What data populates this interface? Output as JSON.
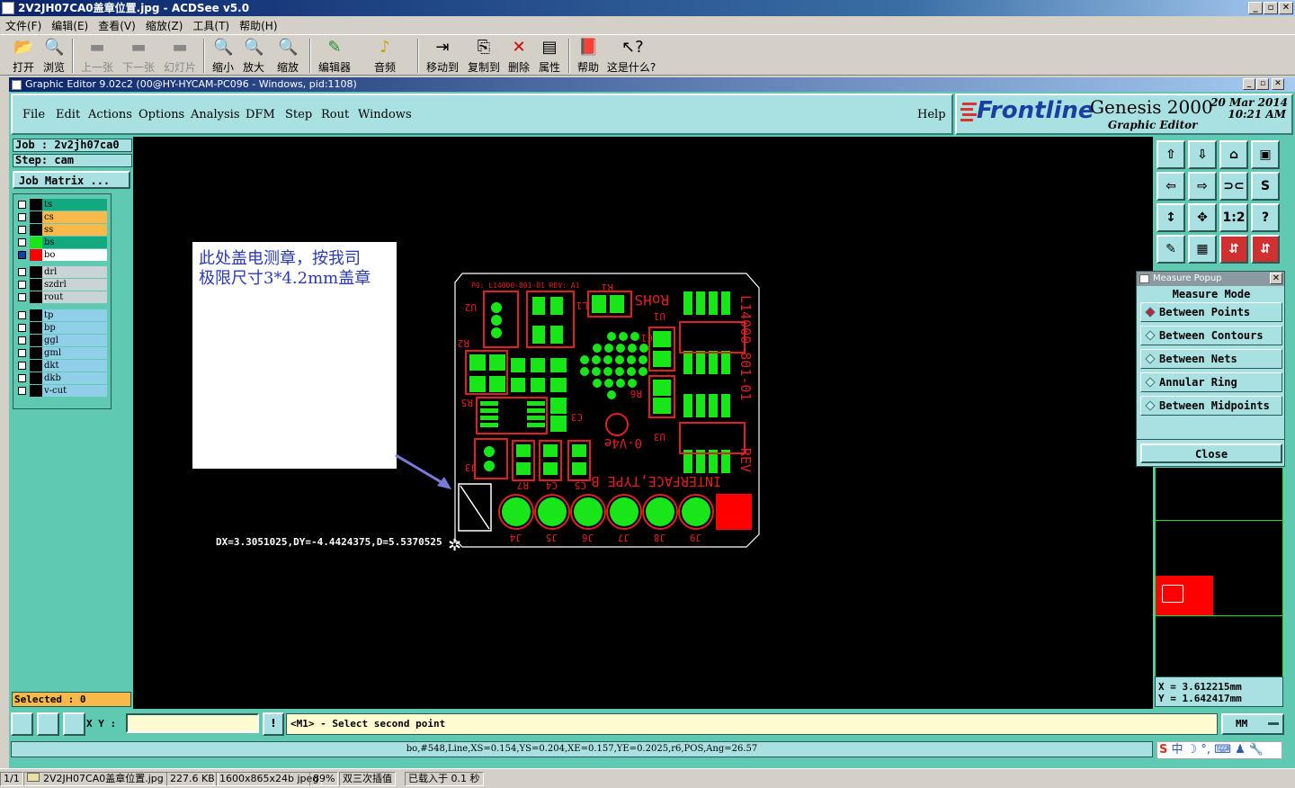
{
  "acdsee": {
    "title": "2V2JH07CA0盖章位置.jpg - ACDSee v5.0",
    "menu": [
      "文件(F)",
      "编辑(E)",
      "查看(V)",
      "缩放(Z)",
      "工具(T)",
      "帮助(H)"
    ],
    "toolbar": [
      "打开",
      "浏览",
      "上一张",
      "下一张",
      "幻灯片",
      "缩小",
      "放大",
      "缩放",
      "编辑器",
      "音频",
      "移动到",
      "复制到",
      "删除",
      "属性",
      "帮助",
      "这是什么?"
    ],
    "status": {
      "index": "1/1",
      "file": "2V2JH07CA0盖章位置.jpg",
      "size": "227.6 KB",
      "dims": "1600x865x24b jpeg",
      "zoom": "89%",
      "interp": "双三次插值",
      "load": "已载入于 0.1 秒"
    }
  },
  "genesis": {
    "window_title": "Graphic Editor 9.02c2 (00@HY-HYCAM-PC096 - Windows, pid:1108)",
    "menu": [
      "File",
      "Edit",
      "Actions",
      "Options",
      "Analysis",
      "DFM",
      "Step",
      "Rout",
      "Windows"
    ],
    "help": "Help",
    "brand": "Frontline",
    "product": "Genesis 2000",
    "subtitle": "Graphic Editor",
    "date": "20 Mar 2014",
    "time": "10:21 AM",
    "job": "Job : 2v2jh07ca0",
    "step": "Step: cam",
    "job_matrix": "Job Matrix ...",
    "layers_a": [
      "ts",
      "cs",
      "ss",
      "bs",
      "bo"
    ],
    "layers_b": [
      "drl",
      "szdrl",
      "rout"
    ],
    "layers_c": [
      "tp",
      "bp",
      "ggl",
      "gml",
      "dkt",
      "dkb",
      "v-cut"
    ],
    "selected": "Selected : 0",
    "colors": {
      "ts": "#12a880",
      "cs": "#f6b94a",
      "ss": "#f6b94a",
      "bs": "#12a880",
      "bo": "#ffffff",
      "gray": "#cad3d6",
      "blue": "#8fd0e8"
    }
  },
  "canvas": {
    "note_line1": "此处盖电测章，按我司",
    "note_line2": "极限尺寸3*4.2mm盖章",
    "measure_readout": "DX=3.3051025,DY=-4.4424375,D=5.5370525",
    "board_top_text": "P0: L14000-801-01 REV: A1",
    "rohs": "RoHS",
    "vertical_text": "L14000-801-01",
    "rev": "REV",
    "iface": "INTERFACE,TYPE B",
    "v0": "0-V4e",
    "refs": [
      "J4",
      "J5",
      "J6",
      "J7",
      "J8",
      "J9",
      "R7",
      "C4",
      "C5",
      "U2",
      "R2",
      "R1",
      "U1",
      "C1",
      "U3",
      "R6",
      "R5",
      "C3",
      "L1",
      "J3"
    ]
  },
  "measure": {
    "title": "Measure Popup",
    "mode": "Measure Mode",
    "options": [
      "Between Points",
      "Between Contours",
      "Between Nets",
      "Annular Ring",
      "Between Midpoints"
    ],
    "close": "Close",
    "x": "X = 3.612215mm",
    "y": "Y = 1.642417mm"
  },
  "command": {
    "xy_label": "X Y :",
    "xy_value": "",
    "prompt": "<M1> - Select second point",
    "units": "MM",
    "info": "bo,#548,Line,XS=0.154,YS=0.204,XE=0.157,YE=0.2025,r6,POS,Ang=26.57"
  }
}
